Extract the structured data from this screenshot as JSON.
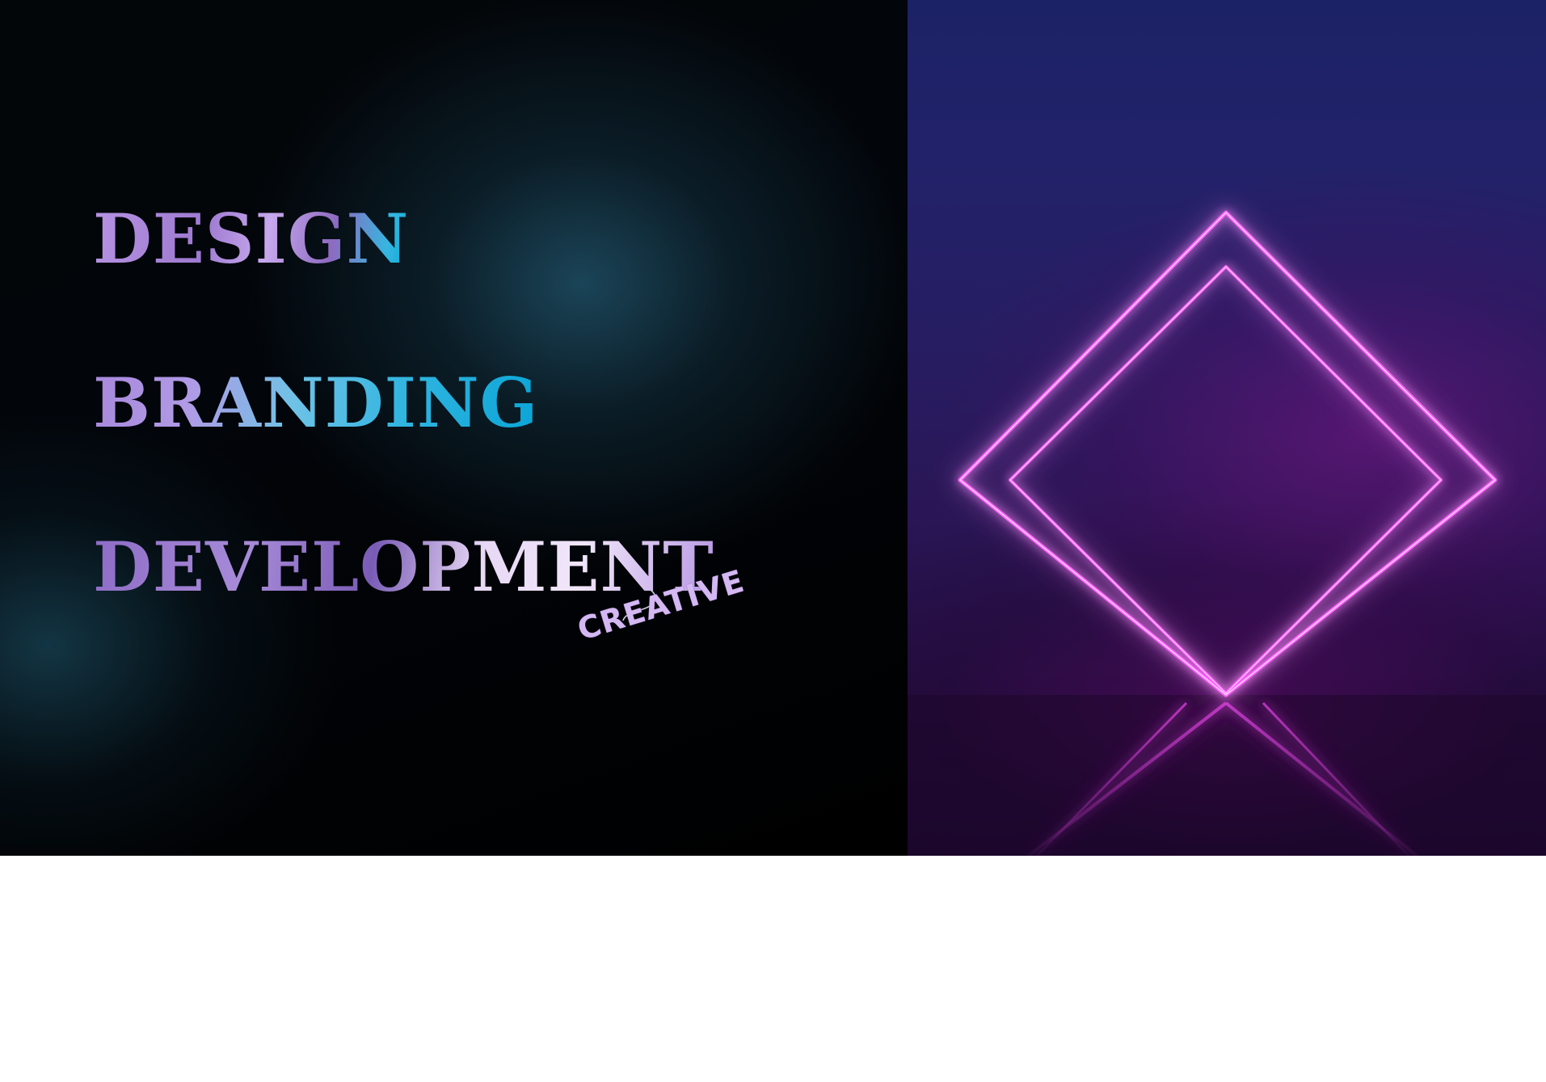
{
  "hero": {
    "words": [
      "DESIGN",
      "BRANDING",
      "DEVELOPMENT"
    ],
    "tag": "CREATIVE"
  },
  "colors": {
    "neon": "#ff4dff",
    "panel_dark": "#000000",
    "panel_right_top": "#1c2266",
    "text_lilac": "#b693e3",
    "text_cyan": "#07a8d8"
  },
  "illustration": {
    "subject": "neon-diamond-frame"
  }
}
